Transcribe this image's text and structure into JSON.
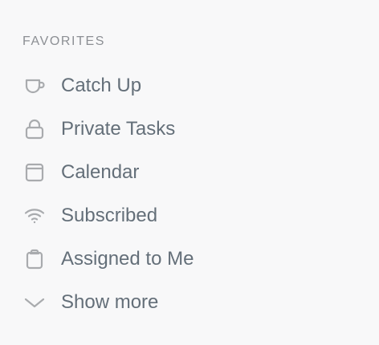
{
  "favorites": {
    "title": "FAVORITES",
    "items": [
      {
        "label": "Catch Up",
        "icon": "cup-icon"
      },
      {
        "label": "Private Tasks",
        "icon": "lock-icon"
      },
      {
        "label": "Calendar",
        "icon": "calendar-icon"
      },
      {
        "label": "Subscribed",
        "icon": "wifi-icon"
      },
      {
        "label": "Assigned to Me",
        "icon": "clipboard-icon"
      },
      {
        "label": "Show more",
        "icon": "chevron-down-icon"
      }
    ]
  },
  "colors": {
    "background": "#f8f8f9",
    "section_title": "#8c8f94",
    "item_text": "#646f79",
    "icon": "#a9abae"
  }
}
